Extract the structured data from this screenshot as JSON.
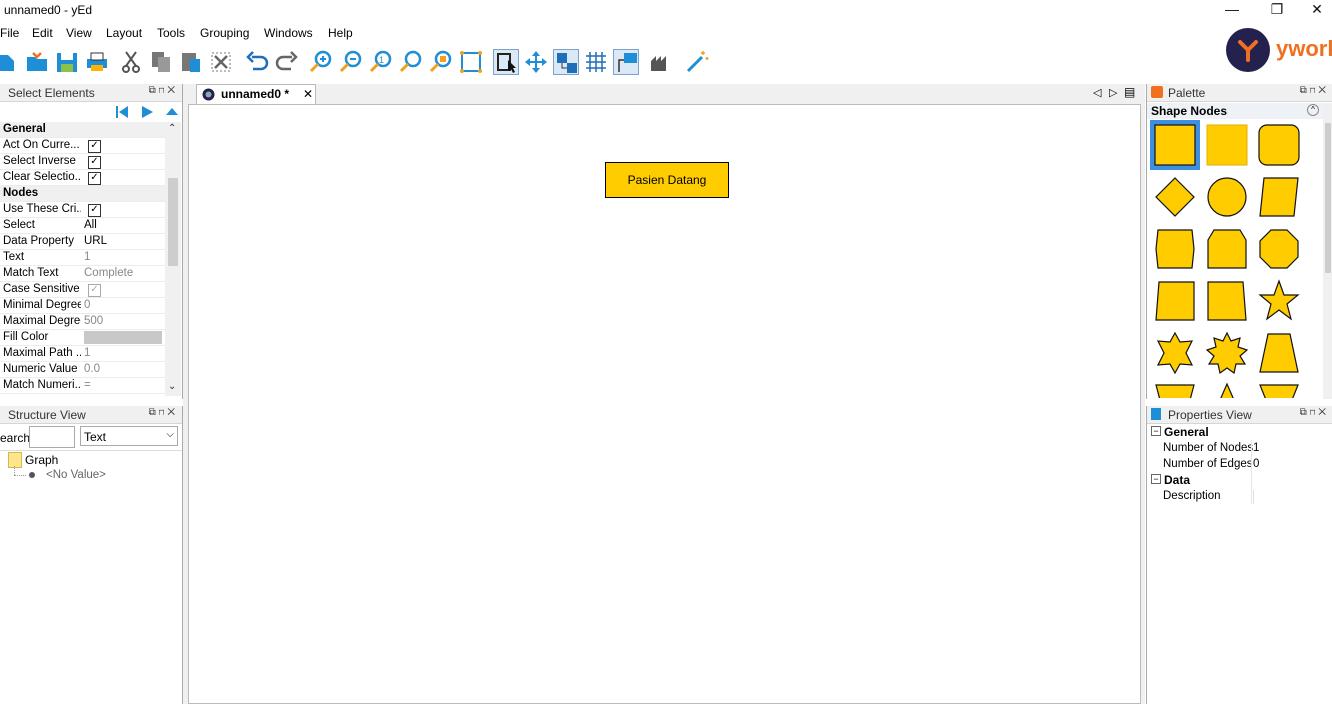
{
  "window": {
    "title": "unnamed0 - yEd",
    "minimize": "—",
    "restore": "❐",
    "close": "✕"
  },
  "menu": [
    "File",
    "Edit",
    "View",
    "Layout",
    "Tools",
    "Grouping",
    "Windows",
    "Help"
  ],
  "logo": {
    "text": "ywork"
  },
  "select_elements": {
    "title": "Select Elements",
    "rows": [
      {
        "key": "General",
        "section": true
      },
      {
        "key": "Act On Curre...",
        "check": true
      },
      {
        "key": "Select Inverse",
        "check": true
      },
      {
        "key": "Clear Selectio...",
        "check": true
      },
      {
        "key": "Nodes",
        "section": true
      },
      {
        "key": "Use These Cri...",
        "check": true
      },
      {
        "key": "Select",
        "value": "All"
      },
      {
        "key": "Data Property",
        "value": "URL"
      },
      {
        "key": "Text",
        "value": "1",
        "grey": true
      },
      {
        "key": "Match Text",
        "value": "Complete",
        "grey": true
      },
      {
        "key": "Case Sensitive",
        "check": true,
        "disabled": true
      },
      {
        "key": "Minimal Degree",
        "value": "0",
        "grey": true
      },
      {
        "key": "Maximal Degree",
        "value": "500",
        "grey": true
      },
      {
        "key": "Fill Color",
        "color": true
      },
      {
        "key": "Maximal Path ...",
        "value": "1",
        "grey": true
      },
      {
        "key": "Numeric Value",
        "value": "0.0",
        "grey": true
      },
      {
        "key": "Match Numeri...",
        "value": "=",
        "grey": true
      }
    ]
  },
  "structure_view": {
    "title": "Structure View",
    "search_label": "earch",
    "search_value": "",
    "filter": "Text",
    "tree_root": "Graph",
    "tree_child": "<No Value>"
  },
  "editor": {
    "tab_label": "unnamed0 *",
    "node_label": "Pasien Datang",
    "node_fill": "#ffcc00"
  },
  "palette": {
    "title": "Palette",
    "section": "Shape Nodes",
    "shape_fill": "#ffcc00"
  },
  "properties_view": {
    "title": "Properties View",
    "general": "General",
    "rows": [
      {
        "key": "Number of Nodes",
        "value": "1"
      },
      {
        "key": "Number of Edges",
        "value": "0"
      }
    ],
    "data": "Data",
    "data_rows": [
      {
        "key": "Description",
        "value": ""
      }
    ]
  }
}
